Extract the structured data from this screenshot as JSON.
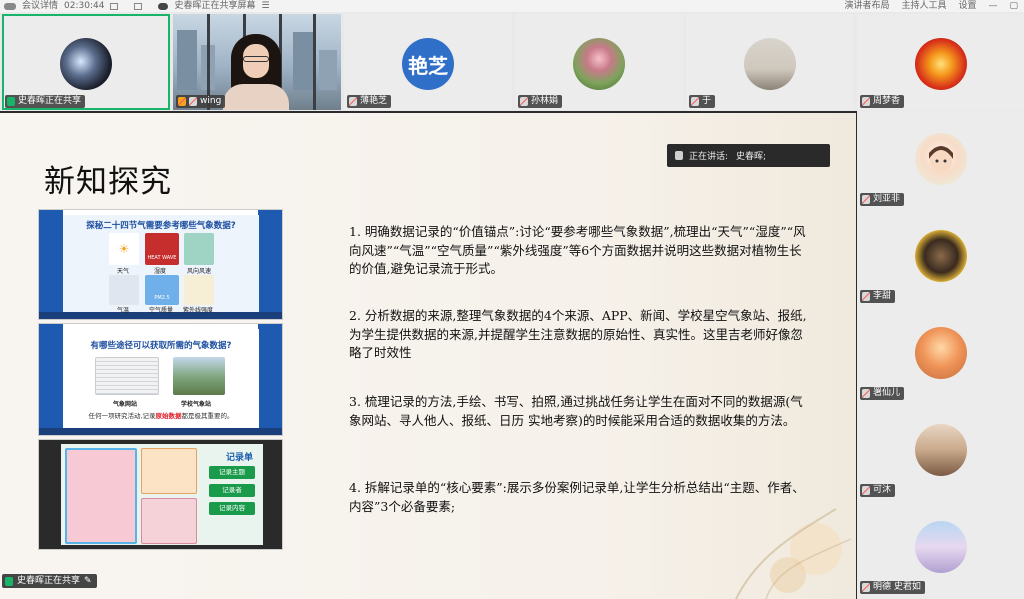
{
  "topbar": {
    "meeting_label": "会议详情",
    "time": "02:30:44",
    "sharing_status": "史春晖正在共享屏幕",
    "layout_label": "演讲者布局",
    "host_tools_label": "主持人工具",
    "settings_label": "设置"
  },
  "participants": [
    {
      "name": "史春晖正在共享",
      "avatar_type": "image"
    },
    {
      "name": "wing",
      "avatar_type": "video"
    },
    {
      "name": "薄艳芝",
      "avatar_text": "艳芝",
      "avatar_color": "#2f6fc8"
    },
    {
      "name": "孙林娟",
      "avatar_type": "image"
    },
    {
      "name": "于",
      "avatar_type": "image"
    },
    {
      "name": "周梦香",
      "avatar_type": "image"
    }
  ],
  "sidebar": [
    {
      "name": "刘亚非"
    },
    {
      "name": "李甜"
    },
    {
      "name": "署仙儿"
    },
    {
      "name": "可沐"
    },
    {
      "name": "明德 史君如"
    }
  ],
  "slide": {
    "title": "新知探究",
    "speaking_label": "正在讲话:",
    "speaking_name": "史春晖;",
    "thumbs": [
      {
        "heading": "探秘二十四节气需要参考哪些气象数据?",
        "labels": [
          "天气",
          "湿度",
          "风向风速",
          "气温",
          "空气质量",
          "紫外线强度"
        ],
        "badge1": "HEAT WAVE",
        "badge2": "PM2.5"
      },
      {
        "heading": "有哪些途径可以获取所需的气象数据?",
        "left_label": "气象网站",
        "right_label": "学校气象站",
        "foot_prefix": "任何一项研究活动,记录",
        "foot_highlight": "原始数据",
        "foot_suffix": "都是极其重要的。"
      },
      {
        "heading": "记录单",
        "buttons": [
          "记录主题",
          "记录者",
          "记录内容"
        ]
      }
    ],
    "points": [
      "1.   明确数据记录的“价值锚点”:讨论“要参考哪些气象数据”,梳理出“天气”“湿度”“风向风速”“气温”“空气质量”“紫外线强度”等6个方面数据并说明这些数据对植物生长的价值,避免记录流于形式。",
      "2.   分析数据的来源,整理气象数据的4个来源、APP、新闻、学校星空气象站、报纸,为学生提供数据的来源,并提醒学生注意数据的原始性、真实性。这里吉老师好像忽略了时效性",
      "3.   梳理记录的方法,手绘、书写、拍照,通过挑战任务让学生在面对不同的数据源(气象网站、寻人他人、报纸、日历    实地考察)的时候能采用合适的数据收集的方法。",
      "4.   拆解记录单的“核心要素”:展示多份案例记录单,让学生分析总结出“主题、作者、内容”3个必备要素;"
    ]
  },
  "sharebar": {
    "label": "史春晖正在共享"
  },
  "colors": {
    "active_border": "#18b46a",
    "slide_blue": "#1d5ab0",
    "highlight_red": "#e0202a"
  }
}
